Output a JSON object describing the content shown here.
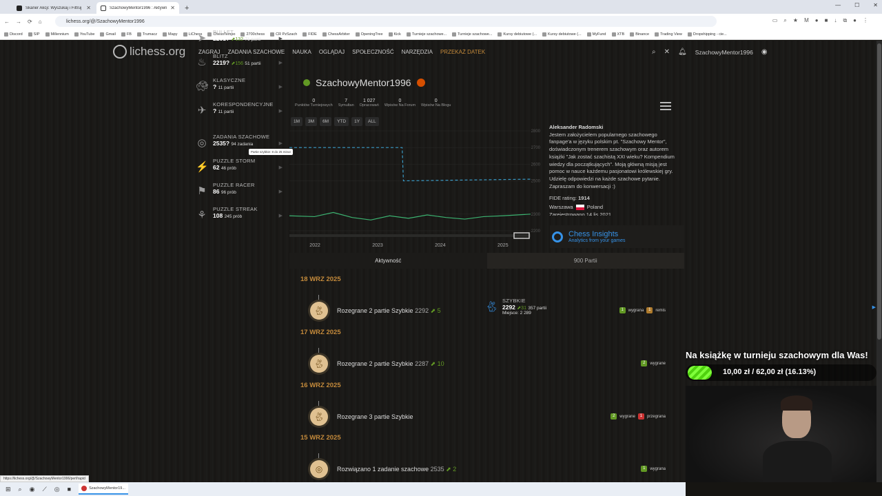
{
  "browser": {
    "tabs": [
      {
        "title": "Skaner Akcji: Wyszukaj i Filtruj",
        "active": false
      },
      {
        "title": "SzachowyMentor1996 : Aktywn",
        "active": true
      }
    ],
    "new_tab": "+",
    "url": "lichess.org/@/SzachowyMentor1996",
    "bookmarks": [
      "Discord",
      "SIP",
      "Millennium",
      "YouTube",
      "Gmail",
      "FB",
      "Trumacz",
      "Mapy",
      "LiChess",
      "ChessTempo",
      "2700chess",
      "CR PzSzach",
      "FIDE",
      "ChessArbiter",
      "OpeningTree",
      "Kick",
      "Turnieje szachowe...",
      "Turnieje szachowe...",
      "Kursy debiutowe (...",
      "Kursy debiutowe (...",
      "MyFund",
      "XTB",
      "Binance",
      "Trading View",
      "Dropshipping - cie..."
    ]
  },
  "site": {
    "logo": "lichess.org",
    "nav": [
      "ZAGRAJ",
      "ZADANIA SZACHOWE",
      "NAUKA",
      "OGLĄDAJ",
      "SPOŁECZNOŚĆ",
      "NARZĘDZIA"
    ],
    "donate": "PRZEKAŻ DATEK",
    "username": "SzachowyMentor1996"
  },
  "side": [
    {
      "name": "BULLET",
      "rating": "2201?",
      "delta": "132",
      "count": "71 partii",
      "icon": "bullet-icon"
    },
    {
      "name": "BLITZ",
      "rating": "2219?",
      "delta": "156",
      "count": "51 partii",
      "icon": "blitz-icon"
    },
    {
      "name": "SZYBKIE",
      "rating": "2292",
      "delta": "31",
      "count": "357 partii",
      "place": "Miejsce: 2 289",
      "icon": "rapid-icon",
      "active": true
    },
    {
      "name": "KLASYCZNE",
      "rating": "?",
      "count": "11 partii",
      "icon": "classical-icon"
    },
    {
      "name": "KORESPONDENCYJNE",
      "rating": "?",
      "count": "11 partii",
      "icon": "correspondence-icon"
    },
    {
      "name": "ZADANIA SZACHOWE",
      "rating": "2535?",
      "count": "94 zadania",
      "icon": "puzzle-icon"
    },
    {
      "name": "PUZZLE STORM",
      "rating": "62",
      "count": "46 prób",
      "icon": "storm-icon"
    },
    {
      "name": "PUZZLE RACER",
      "rating": "86",
      "count": "96 prób",
      "icon": "racer-icon"
    },
    {
      "name": "PUZZLE STREAK",
      "rating": "108",
      "count": "245 prób",
      "icon": "streak-icon"
    }
  ],
  "tooltip": "Partie szybkie: 8 do 25 minut",
  "profile": {
    "name": "SzachowyMentor1996",
    "stats": [
      {
        "v": "0",
        "l": "Punktów Turniejowych"
      },
      {
        "v": "7",
        "l": "Symultan"
      },
      {
        "v": "1 027",
        "l": "Opracowań"
      },
      {
        "v": "0",
        "l": "Wpisów Na Forum"
      },
      {
        "v": "0",
        "l": "Wpisów Na Blogu"
      }
    ],
    "bio_name": "Aleksander Radomski",
    "bio": "Jestem założycielem popularnego szachowego fanpage'a w języku polskim pt. \"Szachowy Mentor\", doświadczonym trenerem szachowym oraz autorem książki \"Jak zostać szachistą XXI wieku? Kompendium wiedzy dla początkujących\". Moją główną misją jest pomoc w nauce każdemu pasjonatowi królewskiej gry. Udzielę odpowiedzi na każde szachowe pytanie. Zapraszam do konwersacji :)",
    "fide_label": "FIDE rating:",
    "fide": "1914",
    "city": "Warszawa",
    "country": "Poland",
    "registered": "Zarejestrowano 14 lis 2021"
  },
  "insights": {
    "title": "Chess Insights",
    "sub": "Analytics from your games"
  },
  "chart_data": {
    "type": "line",
    "periods": [
      "1M",
      "3M",
      "6M",
      "YTD",
      "1Y",
      "ALL"
    ],
    "x_ticks": [
      "2022",
      "2023",
      "2024",
      "2025"
    ],
    "y_ticks": [
      2800,
      2700,
      2600,
      2500,
      2300,
      2200
    ],
    "series": [
      {
        "style": "dashed",
        "color": "#3a9bc7",
        "x": [
          2021.9,
          2023.7,
          2023.72,
          2025.75
        ],
        "values": [
          2700,
          2700,
          2500,
          2510
        ]
      },
      {
        "style": "solid",
        "color": "#3cb371",
        "x": [
          2021.9,
          2022.3,
          2022.6,
          2022.9,
          2023.2,
          2023.5,
          2023.8,
          2024.1,
          2024.4,
          2024.7,
          2025.0,
          2025.3,
          2025.75
        ],
        "values": [
          2290,
          2285,
          2310,
          2280,
          2265,
          2290,
          2275,
          2295,
          2280,
          2270,
          2285,
          2290,
          2300
        ]
      }
    ]
  },
  "ptabs": {
    "activity": "Aktywność",
    "games": "900 Partii"
  },
  "activity": [
    {
      "date": "18 WRZ 2025",
      "text": "Rozegrane 2 partie Szybkie",
      "rating": "2292",
      "delta": "5",
      "res": [
        {
          "n": "1",
          "k": "w",
          "l": "wygrana"
        },
        {
          "n": "1",
          "k": "d",
          "l": "remis"
        }
      ],
      "icon": "rabbit-icon"
    },
    {
      "date": "17 WRZ 2025",
      "text": "Rozegrane 2 partie Szybkie",
      "rating": "2287",
      "delta": "10",
      "res": [
        {
          "n": "2",
          "k": "w",
          "l": "wygrane"
        }
      ],
      "icon": "rabbit-icon"
    },
    {
      "date": "16 WRZ 2025",
      "text": "Rozegrane 3 partie Szybkie",
      "rating": "",
      "delta": "",
      "res": [
        {
          "n": "2",
          "k": "w",
          "l": "wygrane"
        },
        {
          "n": "1",
          "k": "l",
          "l": "przegrana"
        }
      ],
      "icon": "rabbit-icon"
    },
    {
      "date": "15 WRZ 2025",
      "text": "Rozwiązano 1 zadanie szachowe",
      "rating": "2535",
      "delta": "2",
      "res": [
        {
          "n": "1",
          "k": "w",
          "l": "wygrana"
        }
      ],
      "icon": "target-icon"
    }
  ],
  "promo": {
    "title": "Na książkę w turnieju szachowym dla Was!",
    "amount": "10,00 zł / 62,00 zł (16.13%)",
    "fraction": 0.1613
  },
  "status_url": "https://lichess.org/@/SzachowyMentor1996/perf/rapid",
  "taskbar": {
    "app": "SzachowyMentor19..."
  }
}
